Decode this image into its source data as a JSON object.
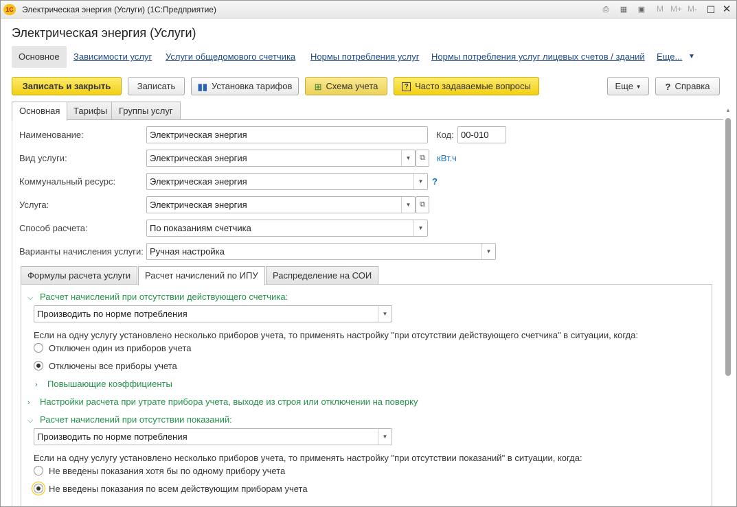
{
  "window": {
    "title": "Электрическая энергия (Услуги)  (1С:Предприятие)",
    "toolbar_m": [
      "M",
      "M+",
      "M-"
    ]
  },
  "form": {
    "title": "Электрическая энергия (Услуги)",
    "nav": {
      "active": "Основное",
      "links": [
        "Зависимости услуг",
        "Услуги общедомового счетчика",
        "Нормы потребления услуг",
        "Нормы потребления услуг лицевых счетов / зданий",
        "Еще..."
      ]
    },
    "buttons": {
      "save_close": "Записать и закрыть",
      "save": "Записать",
      "tariffs": "Установка тарифов",
      "scheme": "Схема учета",
      "faq": "Часто задаваемые вопросы",
      "more": "Еще",
      "help": "Справка"
    },
    "tabs": [
      "Основная",
      "Тарифы",
      "Группы услуг"
    ],
    "fields": {
      "name_label": "Наименование:",
      "name_value": "Электрическая энергия",
      "code_label": "Код:",
      "code_value": "00-010",
      "service_type_label": "Вид услуги:",
      "service_type_value": "Электрическая энергия",
      "unit_link": "кВт.ч",
      "resource_label": "Коммунальный ресурс:",
      "resource_value": "Электрическая энергия",
      "help_mark": "?",
      "service_label": "Услуга:",
      "service_value": "Электрическая энергия",
      "calc_method_label": "Способ расчета:",
      "calc_method_value": "По показаниям счетчика",
      "variants_label": "Варианты начисления услуги:",
      "variants_value": "Ручная настройка"
    },
    "subtabs": [
      "Формулы расчета услуги",
      "Расчет начислений по ИПУ",
      "Распределение на СОИ"
    ],
    "ipu": {
      "group1_title": "Расчет начислений при отсутствии действующего счетчика:",
      "group1_select": "Производить по норме потребления",
      "group1_info": "Если на одну услугу установлено несколько приборов учета, то применять настройку \"при отсутствии действующего счетчика\" в ситуации, когда:",
      "group1_radio1": "Отключен один из приборов учета",
      "group1_radio2": "Отключены все приборы учета",
      "group1_radio_selected": 2,
      "coef_group": "Повышающие коэффициенты",
      "loss_group": "Настройки расчета при утрате прибора учета, выходе из строя или отключении на поверку",
      "group2_title": "Расчет начислений при отсутствии показаний:",
      "group2_select": "Производить по норме потребления",
      "group2_info": "Если на одну услугу установлено несколько приборов учета, то применять настройку \"при отсутствии показаний\" в ситуации, когда:",
      "group2_radio1": "Не введены показания хотя бы по одному прибору учета",
      "group2_radio2": "Не введены показания по всем действующим приборам учета",
      "group2_radio_selected": 2
    }
  }
}
